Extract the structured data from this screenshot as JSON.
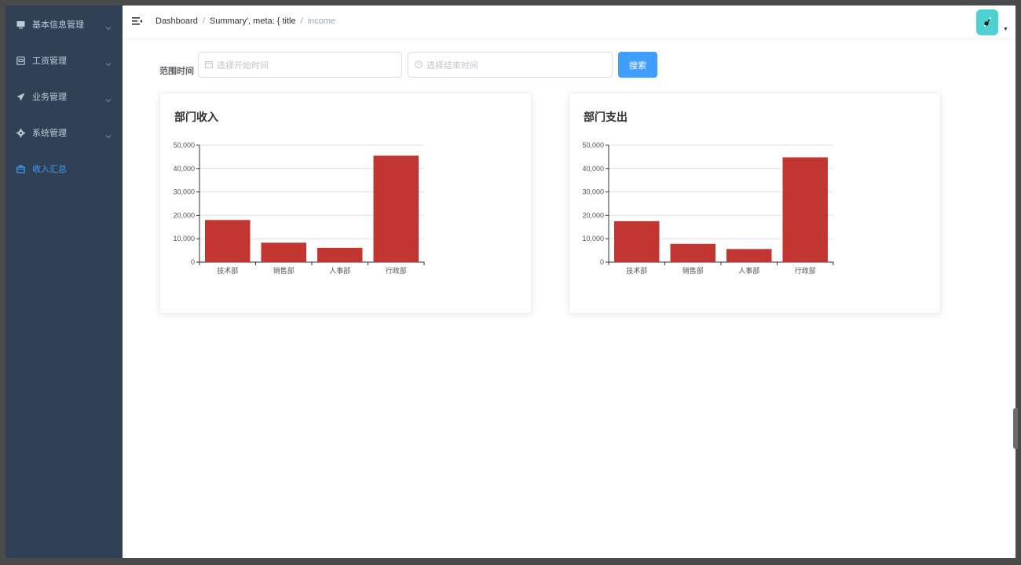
{
  "sidebar": {
    "items": [
      {
        "label": "基本信息管理",
        "icon": "monitor-icon",
        "has_arrow": true
      },
      {
        "label": "工资管理",
        "icon": "wallet-icon",
        "has_arrow": true
      },
      {
        "label": "业务管理",
        "icon": "send-icon",
        "has_arrow": true
      },
      {
        "label": "系统管理",
        "icon": "gear-icon",
        "has_arrow": true
      },
      {
        "label": "收入汇总",
        "icon": "briefcase-icon",
        "has_arrow": false,
        "active": true
      }
    ]
  },
  "breadcrumb": {
    "items": [
      "Dashboard",
      "Summary', meta: { title"
    ],
    "separator": "/",
    "current": "income"
  },
  "filter": {
    "label": "范围时间",
    "start_placeholder": "选择开始时间",
    "end_placeholder": "选择结束时间",
    "search_label": "搜索"
  },
  "colors": {
    "sidebar_bg": "#304156",
    "accent": "#409eff",
    "bar": "#c23531"
  },
  "chart_data": [
    {
      "type": "bar",
      "title": "部门收入",
      "categories": [
        "技术部",
        "销售部",
        "人事部",
        "行政部"
      ],
      "values": [
        18000,
        8300,
        6100,
        45500
      ],
      "ylim": [
        0,
        50000
      ],
      "yticks": [
        "0",
        "10,000",
        "20,000",
        "30,000",
        "40,000",
        "50,000"
      ],
      "grid": true
    },
    {
      "type": "bar",
      "title": "部门支出",
      "categories": [
        "技术部",
        "销售部",
        "人事部",
        "行政部"
      ],
      "values": [
        17500,
        7800,
        5600,
        44800
      ],
      "ylim": [
        0,
        50000
      ],
      "yticks": [
        "0",
        "10,000",
        "20,000",
        "30,000",
        "40,000",
        "50,000"
      ],
      "grid": true
    }
  ]
}
